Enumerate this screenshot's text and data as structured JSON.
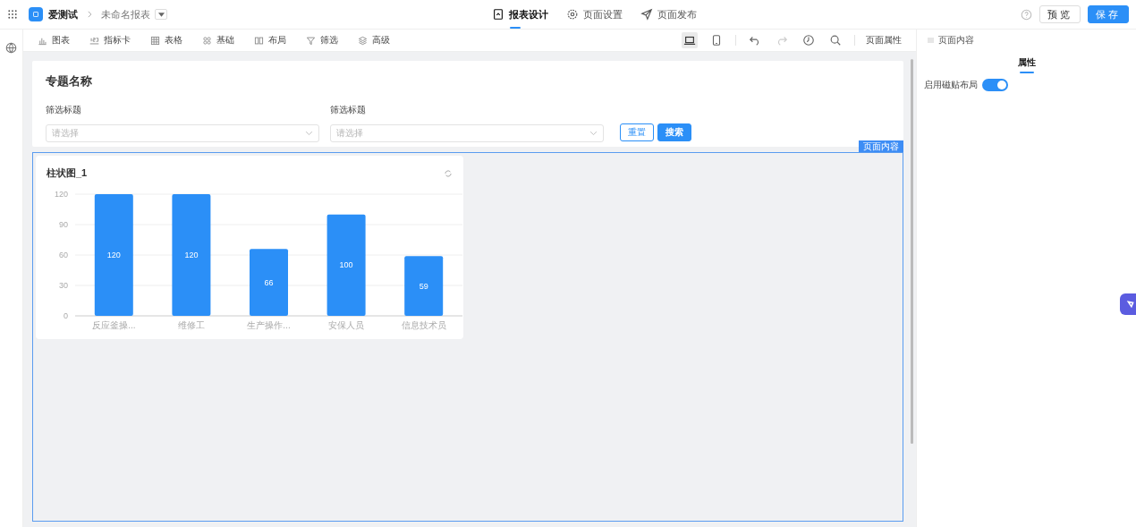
{
  "app": {
    "name": "爱测试",
    "breadcrumb": "未命名报表"
  },
  "nav_tabs": [
    {
      "label": "报表设计",
      "kind": "design",
      "selected": true
    },
    {
      "label": "页面设置",
      "kind": "settings",
      "selected": false
    },
    {
      "label": "页面发布",
      "kind": "publish",
      "selected": false
    }
  ],
  "actions": {
    "preview": "预览",
    "save": "保存"
  },
  "toolbar": {
    "components": [
      {
        "label": "图表",
        "kind": "chart"
      },
      {
        "label": "指标卡",
        "kind": "metric"
      },
      {
        "label": "表格",
        "kind": "table"
      },
      {
        "label": "基础",
        "kind": "basic"
      },
      {
        "label": "布局",
        "kind": "layout"
      },
      {
        "label": "筛选",
        "kind": "filter"
      },
      {
        "label": "高级",
        "kind": "advanced"
      }
    ],
    "devices": [
      {
        "kind": "desktop",
        "selected": true
      },
      {
        "kind": "mobile",
        "selected": false
      }
    ],
    "history": [
      {
        "kind": "undo",
        "disabled": false
      },
      {
        "kind": "redo",
        "disabled": true
      }
    ],
    "page_properties": "页面属性"
  },
  "filter_card": {
    "title": "专题名称",
    "filters": [
      {
        "label": "筛选标题",
        "placeholder": "请选择"
      },
      {
        "label": "筛选标题",
        "placeholder": "请选择"
      }
    ],
    "reset": "重置",
    "search": "搜索"
  },
  "content_tag": "页面内容",
  "chart_card": {
    "title": "柱状图_1",
    "chart_data": {
      "type": "bar",
      "categories": [
        "反应釜操...",
        "维修工",
        "生产操作...",
        "安保人员",
        "信息技术员"
      ],
      "values": [
        120,
        120,
        66,
        100,
        59
      ],
      "grid": true,
      "ylim": [
        0,
        120
      ],
      "yticks": [
        0,
        30,
        60,
        90,
        120
      ],
      "data_labels": true
    }
  },
  "right_panel": {
    "header": "页面内容",
    "tabs": [
      {
        "label": "属性",
        "selected": true
      }
    ],
    "settings": [
      {
        "label": "启用磁贴布局",
        "on": true
      }
    ]
  }
}
